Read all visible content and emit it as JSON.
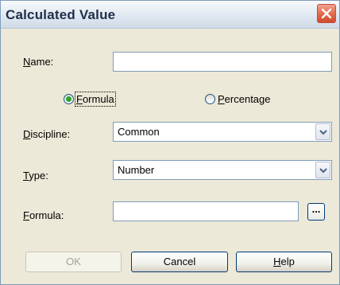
{
  "window": {
    "title": "Calculated Value"
  },
  "fields": {
    "name_label": "Name:",
    "name_value": "",
    "discipline_label": "Discipline:",
    "discipline_value": "Common",
    "type_label": "Type:",
    "type_value": "Number",
    "formula_label": "Formula:",
    "formula_value": ""
  },
  "radios": {
    "formula_label": "Formula",
    "formula_selected": true,
    "percentage_label": "Percentage",
    "percentage_selected": false
  },
  "buttons": {
    "browse": "...",
    "ok": "OK",
    "cancel": "Cancel",
    "help": "Help"
  }
}
